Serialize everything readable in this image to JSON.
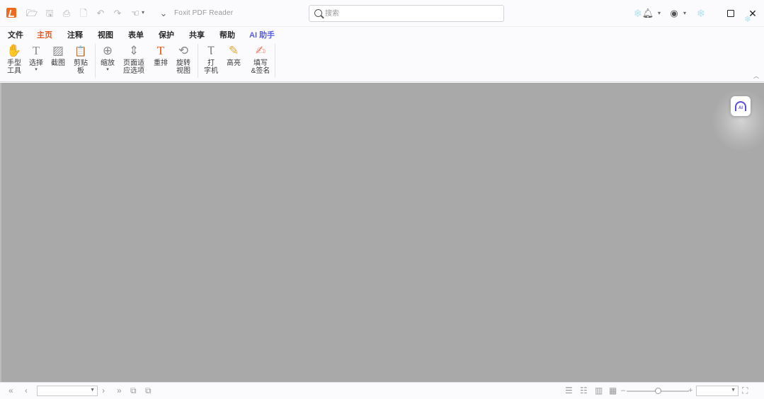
{
  "title_bar": {
    "app_title": "Foxit PDF Reader",
    "search_placeholder": "搜索",
    "quick_access": [
      {
        "icon": "folder-open-icon",
        "glyph": "🗁"
      },
      {
        "icon": "save-icon",
        "glyph": "🖫"
      },
      {
        "icon": "print-icon",
        "glyph": "⎙"
      },
      {
        "icon": "new-doc-icon",
        "glyph": "🗋"
      },
      {
        "icon": "undo-icon",
        "glyph": "↶"
      },
      {
        "icon": "redo-icon",
        "glyph": "↷"
      },
      {
        "icon": "hand-tool-icon",
        "glyph": "☜"
      },
      {
        "icon": "customize-quick-access-icon",
        "glyph": "⌄"
      }
    ]
  },
  "menu_tabs": [
    {
      "label": "文件",
      "active": false
    },
    {
      "label": "主页",
      "active": true
    },
    {
      "label": "注释",
      "active": false
    },
    {
      "label": "视图",
      "active": false
    },
    {
      "label": "表单",
      "active": false
    },
    {
      "label": "保护",
      "active": false
    },
    {
      "label": "共享",
      "active": false
    },
    {
      "label": "帮助",
      "active": false
    },
    {
      "label": "AI 助手",
      "active": false
    }
  ],
  "ribbon": {
    "tools": [
      {
        "label": "手型\n工具",
        "icon": "hand-icon",
        "glyph": "✋",
        "dropdown": false
      },
      {
        "label": "选择",
        "icon": "select-text-icon",
        "glyph": "T",
        "dropdown": true
      },
      {
        "label": "截图",
        "icon": "snapshot-icon",
        "glyph": "▨",
        "dropdown": false
      },
      {
        "label": "剪贴\n板",
        "icon": "clipboard-icon",
        "glyph": "📋",
        "dropdown": true
      },
      {
        "label": "缩放",
        "icon": "zoom-icon",
        "glyph": "⊕",
        "dropdown": true
      },
      {
        "label": "页面适\n应选项",
        "icon": "fit-page-icon",
        "glyph": "⇕",
        "dropdown": true
      },
      {
        "label": "重排",
        "icon": "reflow-icon",
        "glyph": "T",
        "dropdown": false
      },
      {
        "label": "旋转\n视图",
        "icon": "rotate-view-icon",
        "glyph": "⟲",
        "dropdown": true
      },
      {
        "label": "打\n字机",
        "icon": "typewriter-icon",
        "glyph": "Ⲧ",
        "dropdown": false
      },
      {
        "label": "高亮",
        "icon": "highlight-icon",
        "glyph": "✎",
        "dropdown": false
      },
      {
        "label": "填写\n&签名",
        "icon": "fill-sign-icon",
        "glyph": "✍",
        "dropdown": false
      }
    ]
  },
  "status_bar": {
    "nav_icons": [
      "first-page-icon",
      "previous-page-icon",
      "next-page-icon",
      "last-page-icon",
      "previous-view-icon",
      "next-view-icon"
    ],
    "page_value": "",
    "zoom_value": "",
    "zoom_level": 0.5
  },
  "colors": {
    "accent": "#e4561b",
    "ai_accent": "#5a5fe0",
    "doc_background": "#a9a9a9",
    "chrome_background": "#fbfbfd"
  }
}
